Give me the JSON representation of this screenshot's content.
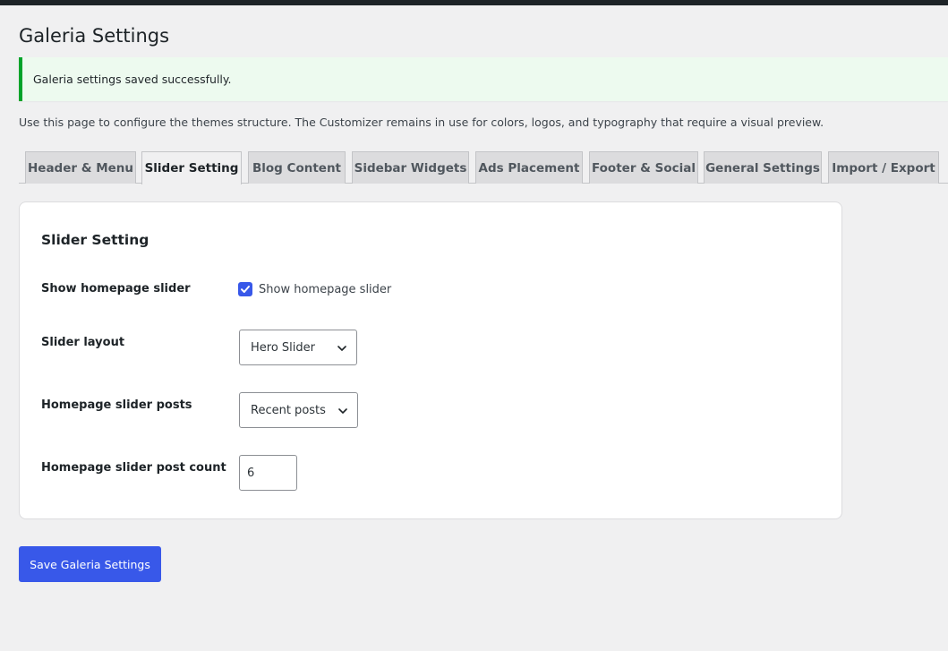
{
  "page_title": "Galeria Settings",
  "notice": "Galeria settings saved successfully.",
  "intro": "Use this page to configure the themes structure. The Customizer remains in use for colors, logos, and typography that require a visual preview.",
  "tabs": [
    {
      "label": "Header & Menu"
    },
    {
      "label": "Slider Setting"
    },
    {
      "label": "Blog Content"
    },
    {
      "label": "Sidebar Widgets"
    },
    {
      "label": "Ads Placement"
    },
    {
      "label": "Footer & Social"
    },
    {
      "label": "General Settings"
    },
    {
      "label": "Import / Export"
    }
  ],
  "active_tab": "Slider Setting",
  "section": {
    "title": "Slider Setting",
    "fields": {
      "show_slider": {
        "label": "Show homepage slider",
        "checkbox_label": "Show homepage slider",
        "checked": true
      },
      "slider_layout": {
        "label": "Slider layout",
        "value": "Hero Slider"
      },
      "slider_posts": {
        "label": "Homepage slider posts",
        "value": "Recent posts"
      },
      "post_count": {
        "label": "Homepage slider post count",
        "value": "6"
      }
    }
  },
  "save_button": "Save Galeria Settings",
  "colors": {
    "accent": "#3858e9",
    "success": "#00a32a",
    "topbar": "#1d2327"
  }
}
